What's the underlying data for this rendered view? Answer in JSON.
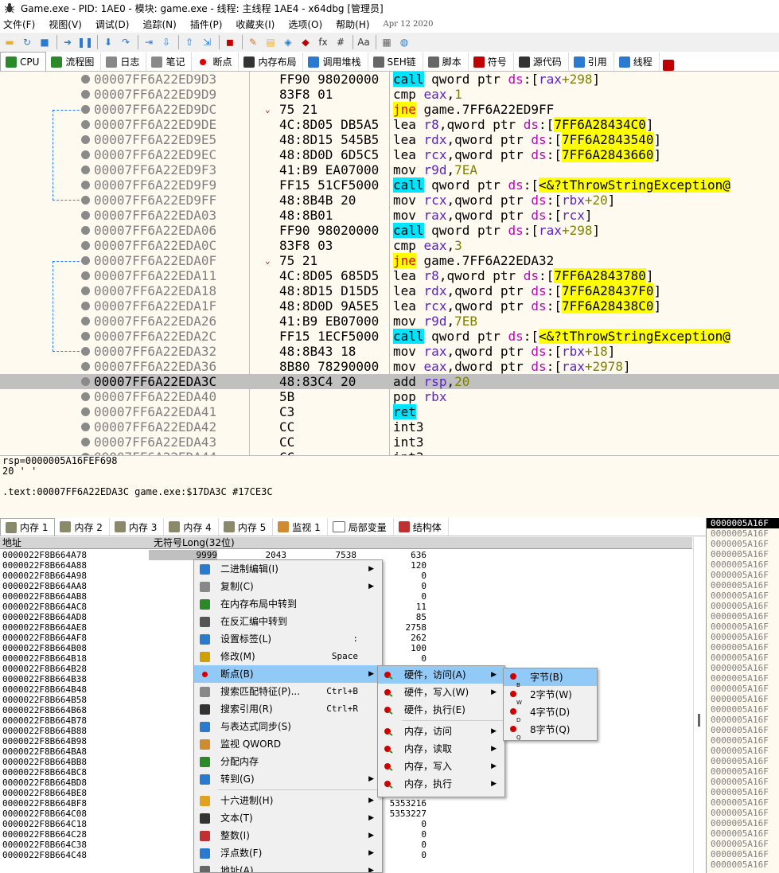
{
  "title": "Game.exe - PID: 1AE0 - 模块: game.exe - 线程: 主线程 1AE4 - x64dbg [管理员]",
  "menu": [
    "文件(F)",
    "视图(V)",
    "调试(D)",
    "追踪(N)",
    "插件(P)",
    "收藏夹(I)",
    "选项(O)",
    "帮助(H)"
  ],
  "build_date": "Apr 12 2020",
  "tabs": [
    "CPU",
    "流程图",
    "日志",
    "笔记",
    "断点",
    "内存布局",
    "调用堆栈",
    "SEH链",
    "脚本",
    "符号",
    "源代码",
    "引用",
    "线程"
  ],
  "disasm": [
    {
      "addr": "00007FF6A22ED9D3",
      "bytes": "FF90 98020000",
      "mn": "call",
      "ops": [
        [
          "t",
          "qword ptr "
        ],
        [
          "s",
          "ds"
        ],
        [
          "t",
          ":["
        ],
        [
          "r",
          "rax"
        ],
        [
          "n",
          "+298"
        ],
        [
          "t",
          "]"
        ]
      ]
    },
    {
      "addr": "00007FF6A22ED9D9",
      "bytes": "83F8 01",
      "mn": "cmp",
      "ops": [
        [
          "r",
          "eax"
        ],
        [
          "t",
          ","
        ],
        [
          "n",
          "1"
        ]
      ]
    },
    {
      "addr": "00007FF6A22ED9DC",
      "bytes": "75 21",
      "arrow": "v",
      "mn": "jne",
      "ops": [
        [
          "t",
          "game.7FF6A22ED9FF"
        ]
      ]
    },
    {
      "addr": "00007FF6A22ED9DE",
      "bytes": "4C:8D05 DB5A5",
      "mn": "lea",
      "ops": [
        [
          "r",
          "r8"
        ],
        [
          "t",
          ",qword ptr "
        ],
        [
          "s",
          "ds"
        ],
        [
          "t",
          ":["
        ],
        [
          "y",
          "7FF6A28434C0"
        ],
        [
          "t",
          "]"
        ]
      ]
    },
    {
      "addr": "00007FF6A22ED9E5",
      "bytes": "48:8D15 545B5",
      "mn": "lea",
      "ops": [
        [
          "r",
          "rdx"
        ],
        [
          "t",
          ",qword ptr "
        ],
        [
          "s",
          "ds"
        ],
        [
          "t",
          ":["
        ],
        [
          "y",
          "7FF6A2843540"
        ],
        [
          "t",
          "]"
        ]
      ]
    },
    {
      "addr": "00007FF6A22ED9EC",
      "bytes": "48:8D0D 6D5C5",
      "mn": "lea",
      "ops": [
        [
          "r",
          "rcx"
        ],
        [
          "t",
          ",qword ptr "
        ],
        [
          "s",
          "ds"
        ],
        [
          "t",
          ":["
        ],
        [
          "y",
          "7FF6A2843660"
        ],
        [
          "t",
          "]"
        ]
      ]
    },
    {
      "addr": "00007FF6A22ED9F3",
      "bytes": "41:B9 EA07000",
      "mn": "mov",
      "ops": [
        [
          "r",
          "r9d"
        ],
        [
          "t",
          ","
        ],
        [
          "n",
          "7EA"
        ]
      ]
    },
    {
      "addr": "00007FF6A22ED9F9",
      "bytes": "FF15 51CF5000",
      "mn": "call",
      "ops": [
        [
          "t",
          "qword ptr "
        ],
        [
          "s",
          "ds"
        ],
        [
          "t",
          ":["
        ],
        [
          "y",
          "<&?tThrowStringException@"
        ]
      ]
    },
    {
      "addr": "00007FF6A22ED9FF",
      "bytes": "48:8B4B 20",
      "mn": "mov",
      "ops": [
        [
          "r",
          "rcx"
        ],
        [
          "t",
          ",qword ptr "
        ],
        [
          "s",
          "ds"
        ],
        [
          "t",
          ":["
        ],
        [
          "r",
          "rbx"
        ],
        [
          "n",
          "+20"
        ],
        [
          "t",
          "]"
        ]
      ]
    },
    {
      "addr": "00007FF6A22EDA03",
      "bytes": "48:8B01",
      "mn": "mov",
      "ops": [
        [
          "r",
          "rax"
        ],
        [
          "t",
          ",qword ptr "
        ],
        [
          "s",
          "ds"
        ],
        [
          "t",
          ":["
        ],
        [
          "r",
          "rcx"
        ],
        [
          "t",
          "]"
        ]
      ]
    },
    {
      "addr": "00007FF6A22EDA06",
      "bytes": "FF90 98020000",
      "mn": "call",
      "ops": [
        [
          "t",
          "qword ptr "
        ],
        [
          "s",
          "ds"
        ],
        [
          "t",
          ":["
        ],
        [
          "r",
          "rax"
        ],
        [
          "n",
          "+298"
        ],
        [
          "t",
          "]"
        ]
      ]
    },
    {
      "addr": "00007FF6A22EDA0C",
      "bytes": "83F8 03",
      "mn": "cmp",
      "ops": [
        [
          "r",
          "eax"
        ],
        [
          "t",
          ","
        ],
        [
          "n",
          "3"
        ]
      ]
    },
    {
      "addr": "00007FF6A22EDA0F",
      "bytes": "75 21",
      "arrow": "v",
      "mn": "jne",
      "ops": [
        [
          "t",
          "game.7FF6A22EDA32"
        ]
      ]
    },
    {
      "addr": "00007FF6A22EDA11",
      "bytes": "4C:8D05 685D5",
      "mn": "lea",
      "ops": [
        [
          "r",
          "r8"
        ],
        [
          "t",
          ",qword ptr "
        ],
        [
          "s",
          "ds"
        ],
        [
          "t",
          ":["
        ],
        [
          "y",
          "7FF6A2843780"
        ],
        [
          "t",
          "]"
        ]
      ]
    },
    {
      "addr": "00007FF6A22EDA18",
      "bytes": "48:8D15 D15D5",
      "mn": "lea",
      "ops": [
        [
          "r",
          "rdx"
        ],
        [
          "t",
          ",qword ptr "
        ],
        [
          "s",
          "ds"
        ],
        [
          "t",
          ":["
        ],
        [
          "y",
          "7FF6A28437F0"
        ],
        [
          "t",
          "]"
        ]
      ]
    },
    {
      "addr": "00007FF6A22EDA1F",
      "bytes": "48:8D0D 9A5E5",
      "mn": "lea",
      "ops": [
        [
          "r",
          "rcx"
        ],
        [
          "t",
          ",qword ptr "
        ],
        [
          "s",
          "ds"
        ],
        [
          "t",
          ":["
        ],
        [
          "y",
          "7FF6A28438C0"
        ],
        [
          "t",
          "]"
        ]
      ]
    },
    {
      "addr": "00007FF6A22EDA26",
      "bytes": "41:B9 EB07000",
      "mn": "mov",
      "ops": [
        [
          "r",
          "r9d"
        ],
        [
          "t",
          ","
        ],
        [
          "n",
          "7EB"
        ]
      ]
    },
    {
      "addr": "00007FF6A22EDA2C",
      "bytes": "FF15 1ECF5000",
      "mn": "call",
      "ops": [
        [
          "t",
          "qword ptr "
        ],
        [
          "s",
          "ds"
        ],
        [
          "t",
          ":["
        ],
        [
          "y",
          "<&?tThrowStringException@"
        ]
      ]
    },
    {
      "addr": "00007FF6A22EDA32",
      "bytes": "48:8B43 18",
      "mn": "mov",
      "ops": [
        [
          "r",
          "rax"
        ],
        [
          "t",
          ",qword ptr "
        ],
        [
          "s",
          "ds"
        ],
        [
          "t",
          ":["
        ],
        [
          "r",
          "rbx"
        ],
        [
          "n",
          "+18"
        ],
        [
          "t",
          "]"
        ]
      ]
    },
    {
      "addr": "00007FF6A22EDA36",
      "bytes": "8B80 78290000",
      "mn": "mov",
      "ops": [
        [
          "r",
          "eax"
        ],
        [
          "t",
          ",dword ptr "
        ],
        [
          "s",
          "ds"
        ],
        [
          "t",
          ":["
        ],
        [
          "r",
          "rax"
        ],
        [
          "n",
          "+2978"
        ],
        [
          "t",
          "]"
        ]
      ]
    },
    {
      "addr": "00007FF6A22EDA3C",
      "bytes": "48:83C4 20",
      "sel": true,
      "mn": "add",
      "ops": [
        [
          "r",
          "rsp"
        ],
        [
          "t",
          ","
        ],
        [
          "n",
          "20"
        ]
      ]
    },
    {
      "addr": "00007FF6A22EDA40",
      "bytes": "5B",
      "mn": "pop",
      "ops": [
        [
          "r",
          "rbx"
        ]
      ]
    },
    {
      "addr": "00007FF6A22EDA41",
      "bytes": "C3",
      "mn": "ret",
      "ops": []
    },
    {
      "addr": "00007FF6A22EDA42",
      "bytes": "CC",
      "mn": "int3",
      "ops": []
    },
    {
      "addr": "00007FF6A22EDA43",
      "bytes": "CC",
      "mn": "int3",
      "ops": []
    },
    {
      "addr": "00007FF6A22EDA44",
      "bytes": "CC",
      "mn": "int3",
      "ops": []
    }
  ],
  "info": {
    "line1": "rsp=0000005A16FEF698",
    "line2": "20 ' '",
    "line3": ".text:00007FF6A22EDA3C game.exe:$17DA3C #17CE3C"
  },
  "mem_tabs": [
    "内存 1",
    "内存 2",
    "内存 3",
    "内存 4",
    "内存 5",
    "监视 1",
    "局部变量",
    "结构体"
  ],
  "dump": {
    "col_addr": "地址",
    "col_type": "无符号Long(32位)",
    "rows": [
      {
        "a": "0000022F8B664A78",
        "v": [
          "9999",
          "2043",
          "7538",
          "636"
        ]
      },
      {
        "a": "0000022F8B664A88",
        "v": [
          "",
          "",
          "",
          "120"
        ]
      },
      {
        "a": "0000022F8B664A98",
        "v": [
          "",
          "",
          "",
          "0"
        ]
      },
      {
        "a": "0000022F8B664AA8",
        "v": [
          "",
          "",
          "",
          "0"
        ]
      },
      {
        "a": "0000022F8B664AB8",
        "v": [
          "",
          "",
          "",
          "0"
        ]
      },
      {
        "a": "0000022F8B664AC8",
        "v": [
          "",
          "",
          "",
          "11"
        ]
      },
      {
        "a": "0000022F8B664AD8",
        "v": [
          "",
          "",
          "",
          "85"
        ]
      },
      {
        "a": "0000022F8B664AE8",
        "v": [
          "",
          "",
          "",
          "2758"
        ]
      },
      {
        "a": "0000022F8B664AF8",
        "v": [
          "",
          "",
          "",
          "262"
        ]
      },
      {
        "a": "0000022F8B664B08",
        "v": [
          "",
          "",
          "",
          "100"
        ]
      },
      {
        "a": "0000022F8B664B18",
        "v": [
          "",
          "",
          "",
          "0"
        ]
      },
      {
        "a": "0000022F8B664B28",
        "v": [
          "",
          "",
          "",
          ""
        ]
      },
      {
        "a": "0000022F8B664B38",
        "v": [
          "",
          "",
          "",
          ""
        ]
      },
      {
        "a": "0000022F8B664B48",
        "v": [
          "",
          "",
          "",
          ""
        ]
      },
      {
        "a": "0000022F8B664B58",
        "v": [
          "",
          "",
          "",
          ""
        ]
      },
      {
        "a": "0000022F8B664B68",
        "v": [
          "",
          "",
          "",
          ""
        ]
      },
      {
        "a": "0000022F8B664B78",
        "v": [
          "",
          "",
          "",
          ""
        ]
      },
      {
        "a": "0000022F8B664B88",
        "v": [
          "",
          "",
          "",
          ""
        ]
      },
      {
        "a": "0000022F8B664B98",
        "v": [
          "",
          "",
          "",
          ""
        ]
      },
      {
        "a": "0000022F8B664BA8",
        "v": [
          "",
          "",
          "",
          ""
        ]
      },
      {
        "a": "0000022F8B664BB8",
        "v": [
          "",
          "",
          "",
          ""
        ]
      },
      {
        "a": "0000022F8B664BC8",
        "v": [
          "",
          "",
          "",
          ""
        ]
      },
      {
        "a": "0000022F8B664BD8",
        "v": [
          "",
          "",
          "",
          ""
        ]
      },
      {
        "a": "0000022F8B664BE8",
        "v": [
          "",
          "",
          "",
          ""
        ]
      },
      {
        "a": "0000022F8B664BF8",
        "v": [
          "",
          "",
          "",
          "5353216"
        ]
      },
      {
        "a": "0000022F8B664C08",
        "v": [
          "",
          "",
          "",
          "5353227"
        ]
      },
      {
        "a": "0000022F8B664C18",
        "v": [
          "",
          "",
          "",
          "0"
        ]
      },
      {
        "a": "0000022F8B664C28",
        "v": [
          "",
          "",
          "",
          "0"
        ]
      },
      {
        "a": "0000022F8B664C38",
        "v": [
          "",
          "",
          "",
          "0"
        ]
      },
      {
        "a": "0000022F8B664C48",
        "v": [
          "",
          "",
          "",
          "0"
        ]
      }
    ]
  },
  "stack": {
    "header": "0000005A16F",
    "row": "0000005A16F"
  },
  "context_menu": [
    {
      "icon": "binary-edit-icon",
      "label": "二进制编辑(I)",
      "sub": true
    },
    {
      "icon": "copy-icon",
      "label": "复制(C)",
      "sub": true
    },
    {
      "icon": "memory-map-icon",
      "label": "在内存布局中转到"
    },
    {
      "icon": "disasm-icon",
      "label": "在反汇编中转到"
    },
    {
      "icon": "label-icon",
      "label": "设置标签(L)",
      "sc": ":"
    },
    {
      "icon": "pencil-icon",
      "label": "修改(M)",
      "sc": "Space"
    },
    {
      "icon": "breakpoint-icon",
      "label": "断点(B)",
      "sub": true,
      "hl": true
    },
    {
      "icon": "search-icon",
      "label": "搜索匹配特征(P)...",
      "sc": "Ctrl+B"
    },
    {
      "icon": "binoculars-icon",
      "label": "搜索引用(R)",
      "sc": "Ctrl+R"
    },
    {
      "icon": "sync-icon",
      "label": "与表达式同步(S)"
    },
    {
      "icon": "watch-icon",
      "label": "监视 QWORD"
    },
    {
      "icon": "allocate-icon",
      "label": "分配内存"
    },
    {
      "icon": "goto-icon",
      "label": "转到(G)",
      "sub": true
    },
    {
      "sep": true
    },
    {
      "icon": "hex-icon",
      "label": "十六进制(H)",
      "sub": true
    },
    {
      "icon": "text-icon",
      "label": "文本(T)",
      "sub": true
    },
    {
      "icon": "integer-icon",
      "label": "整数(I)",
      "sub": true
    },
    {
      "icon": "float-icon",
      "label": "浮点数(F)",
      "sub": true
    },
    {
      "icon": "address-icon",
      "label": "地址(A)",
      "sub": true
    }
  ],
  "bp_menu": [
    {
      "label": "硬件，访问(A)",
      "sub": true,
      "hl": true
    },
    {
      "label": "硬件，写入(W)",
      "sub": true
    },
    {
      "label": "硬件，执行(E)"
    },
    {
      "sep": true
    },
    {
      "label": "内存，访问",
      "sub": true
    },
    {
      "label": "内存，读取",
      "sub": true
    },
    {
      "label": "内存，写入",
      "sub": true
    },
    {
      "label": "内存，执行",
      "sub": true
    }
  ],
  "size_menu": [
    {
      "label": "字节(B)",
      "hl": true,
      "tag": "B"
    },
    {
      "label": "2字节(W)",
      "tag": "W"
    },
    {
      "label": "4字节(D)",
      "tag": "D"
    },
    {
      "label": "8字节(Q)",
      "tag": "Q"
    }
  ],
  "colors": {
    "call_bg": "#00e5ff",
    "jne_bg": "#ffff00",
    "highlight": "#91c9f7",
    "reg": "#5b20d0",
    "seg": "#c000c0",
    "num": "#808000"
  }
}
